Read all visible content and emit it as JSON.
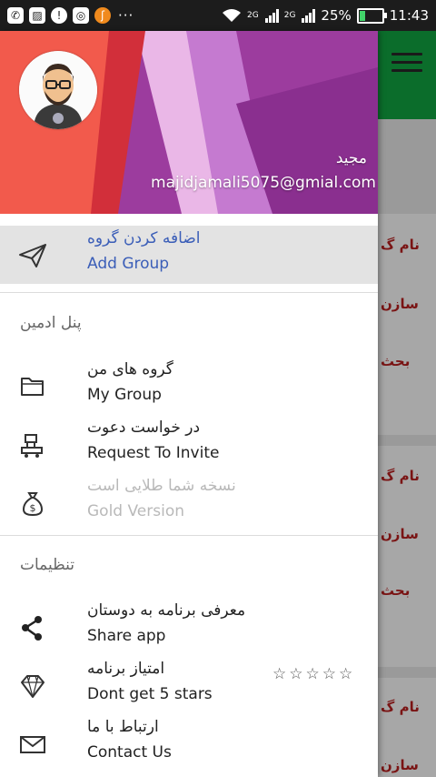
{
  "status_bar": {
    "icons_left": [
      "whatsapp-icon",
      "image-icon",
      "alert-icon",
      "instagram-icon",
      "app-icon"
    ],
    "overflow": "···",
    "network": [
      "2G",
      "2G"
    ],
    "battery": "25%",
    "battery_level": 0.25,
    "time": "11:43"
  },
  "drawer": {
    "header": {
      "name": "مجید",
      "email": "majidjamali5075@gmial.com",
      "colors": [
        "#e8303a",
        "#a03fa6",
        "#d6a6e8"
      ]
    },
    "items": [
      {
        "fa": "اضافه کردن گروه",
        "en": "Add Group",
        "icon": "send-icon",
        "state": "active"
      },
      {
        "fa": "گروه های من",
        "en": "My Group",
        "icon": "folder-icon"
      },
      {
        "fa": "در خواست دعوت",
        "en": "Request To Invite",
        "icon": "invite-icon"
      },
      {
        "fa": "نسخه شما طلایی است",
        "en": "Gold Version",
        "icon": "money-bag-icon",
        "state": "disabled"
      },
      {
        "fa": "معرفی برنامه به دوستان",
        "en": "Share app",
        "icon": "share-icon"
      },
      {
        "fa": "امتیاز برنامه",
        "en": "Dont get 5 stars",
        "icon": "diamond-icon",
        "stars": "☆☆☆☆☆"
      },
      {
        "fa": "ارتباط با ما",
        "en": "Contact Us",
        "icon": "mail-icon"
      }
    ],
    "sections": {
      "admin": "پنل ادمین",
      "settings": "تنظیمات"
    }
  },
  "background_app": {
    "menu_icon": "hamburger-icon",
    "card_lines": [
      "نام گ",
      "سازن",
      "بحث",
      "نام گ",
      "سازن",
      "بحث",
      "نام گ",
      "سازن"
    ],
    "toolbar_color": "#0b6d2b"
  }
}
